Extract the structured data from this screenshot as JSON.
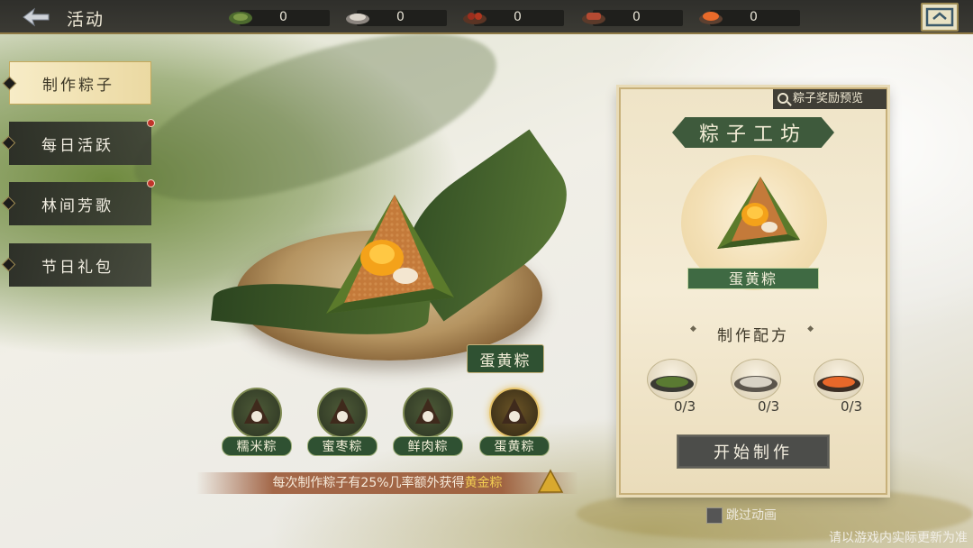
{
  "header": {
    "title": "活动",
    "resources": [
      {
        "icon": "rice-leaf-icon",
        "value": "0"
      },
      {
        "icon": "glutinous-rice-icon",
        "value": "0"
      },
      {
        "icon": "jujube-icon",
        "value": "0"
      },
      {
        "icon": "meat-icon",
        "value": "0"
      },
      {
        "icon": "egg-yolk-icon",
        "value": "0"
      }
    ]
  },
  "sidebar": {
    "items": [
      {
        "label": "制作粽子",
        "active": true,
        "badge": false
      },
      {
        "label": "每日活跃",
        "active": false,
        "badge": true
      },
      {
        "label": "林间芳歌",
        "active": false,
        "badge": true
      },
      {
        "label": "节日礼包",
        "active": false,
        "badge": false
      }
    ]
  },
  "main": {
    "selected_label": "蛋黄粽",
    "picks": [
      {
        "name": "糯米粽",
        "active": false
      },
      {
        "name": "蜜枣粽",
        "active": false
      },
      {
        "name": "鲜肉粽",
        "active": false
      },
      {
        "name": "蛋黄粽",
        "active": true
      }
    ],
    "tip_prefix": "每次制作粽子有25%几率额外获得",
    "tip_gold": "黄金粽"
  },
  "workshop": {
    "preview_label": "粽子奖励预览",
    "title": "粽子工坊",
    "zongzi_name": "蛋黄粽",
    "recipe_label": "制作配方",
    "ingredients": [
      {
        "icon": "rice-leaf-icon",
        "count": "0/3"
      },
      {
        "icon": "glutinous-rice-icon",
        "count": "0/3"
      },
      {
        "icon": "egg-yolk-icon",
        "count": "0/3"
      }
    ],
    "start_label": "开始制作"
  },
  "footer": {
    "skip_label": "跳过动画",
    "notice": "请以游戏内实际更新为准"
  },
  "colors": {
    "accent_green": "#2f5132",
    "gold": "#f3cf52",
    "badge_red": "#c0342a"
  }
}
